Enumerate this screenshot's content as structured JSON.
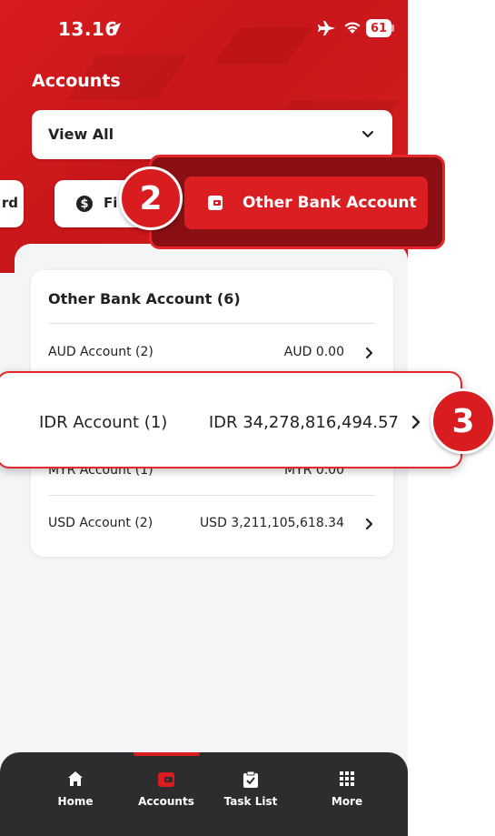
{
  "status_bar": {
    "time": "13.16",
    "battery": "61"
  },
  "header": {
    "title": "Accounts"
  },
  "filter": {
    "selected": "View All"
  },
  "chips": {
    "partial_left_label": "rd",
    "fx_label": "Fi",
    "active_label": "Other Bank Account"
  },
  "steps": {
    "badge_2": "2",
    "badge_3": "3"
  },
  "group": {
    "title": "Other Bank Account (6)",
    "rows": [
      {
        "name": "AUD Account (2)",
        "amount": "AUD 0.00"
      },
      {
        "name": "IDR Account (1)",
        "amount": "IDR 34,278,816,494.57"
      },
      {
        "name": "MYR Account (1)",
        "amount": "MYR 0.00"
      },
      {
        "name": "USD Account (2)",
        "amount": "USD 3,211,105,618.34"
      }
    ]
  },
  "nav": {
    "items": [
      {
        "label": "Home",
        "icon": "home-icon"
      },
      {
        "label": "Accounts",
        "icon": "wallet-icon"
      },
      {
        "label": "Task List",
        "icon": "clipboard-check-icon"
      },
      {
        "label": "More",
        "icon": "grid-icon"
      }
    ],
    "active_color": "#d81c1f"
  },
  "colors": {
    "brand_red": "#d81c1f",
    "highlight_border": "#e5262a",
    "nav_bg": "#2d2d2f"
  }
}
